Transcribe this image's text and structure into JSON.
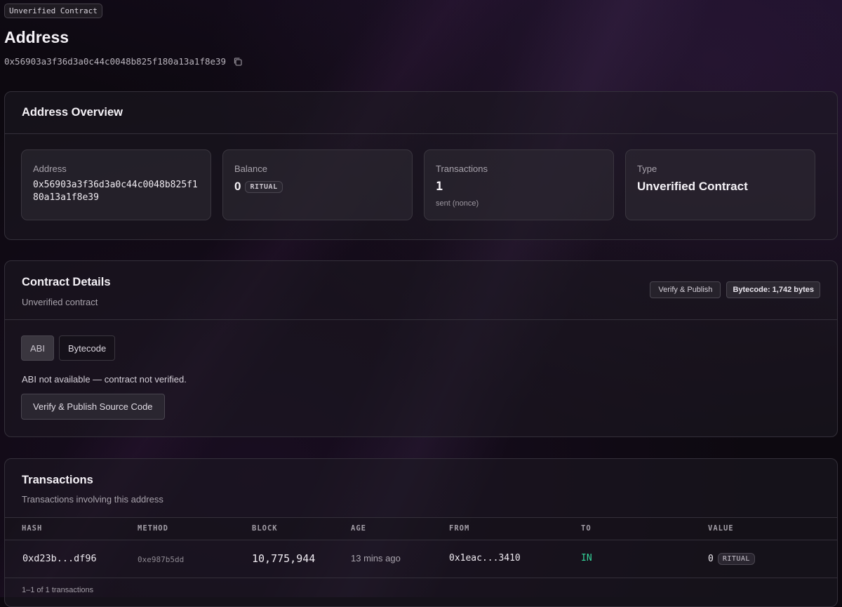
{
  "header": {
    "badge": "Unverified Contract",
    "title": "Address",
    "address": "0x56903a3f36d3a0c44c0048b825f180a13a1f8e39"
  },
  "overview": {
    "title": "Address Overview",
    "address_label": "Address",
    "address_value": "0x56903a3f36d3a0c44c0048b825f180a13a1f8e39",
    "balance_label": "Balance",
    "balance_value": "0",
    "balance_unit": "RITUAL",
    "tx_label": "Transactions",
    "tx_value": "1",
    "tx_note": "sent (nonce)",
    "type_label": "Type",
    "type_value": "Unverified Contract"
  },
  "contract": {
    "title": "Contract Details",
    "subtitle": "Unverified contract",
    "verify_label": "Verify & Publish",
    "bytecode_badge": "Bytecode: 1,742 bytes",
    "tabs": [
      {
        "label": "ABI",
        "active": true
      },
      {
        "label": "Bytecode",
        "active": false
      }
    ],
    "message": "ABI not available — contract not verified.",
    "verify_source_label": "Verify & Publish Source Code"
  },
  "transactions": {
    "title": "Transactions",
    "subtitle": "Transactions involving this address",
    "columns": [
      "HASH",
      "METHOD",
      "BLOCK",
      "AGE",
      "FROM",
      "TO",
      "VALUE"
    ],
    "rows": [
      {
        "hash": "0xd23b...df96",
        "method": "0xe987b5dd",
        "block": "10,775,944",
        "age": "13 mins ago",
        "from": "0x1eac...3410",
        "to": "IN",
        "value": "0",
        "unit": "RITUAL"
      }
    ],
    "footer": "1–1 of 1 transactions"
  },
  "icons": {
    "copy": "copy-icon"
  },
  "colors": {
    "in_direction": "#34d399",
    "background": "#0d0910"
  }
}
